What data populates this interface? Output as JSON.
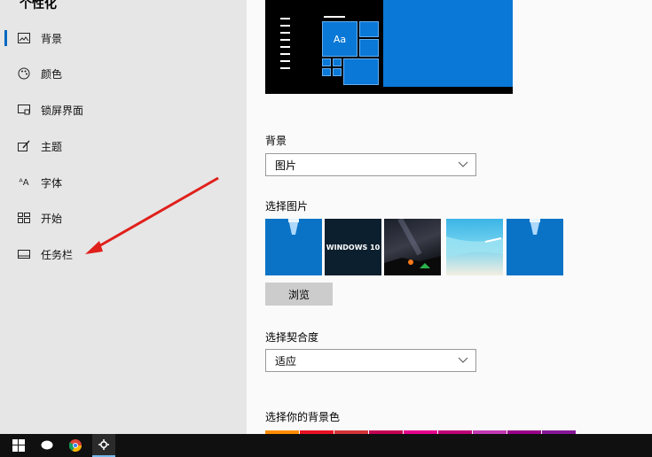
{
  "sidebar": {
    "title": "个性化",
    "items": [
      {
        "label": "背景",
        "icon": "picture-icon",
        "selected": true
      },
      {
        "label": "颜色",
        "icon": "palette-icon",
        "selected": false
      },
      {
        "label": "锁屏界面",
        "icon": "lock-screen-icon",
        "selected": false
      },
      {
        "label": "主题",
        "icon": "theme-icon",
        "selected": false
      },
      {
        "label": "字体",
        "icon": "font-icon",
        "selected": false
      },
      {
        "label": "开始",
        "icon": "start-icon",
        "selected": false
      },
      {
        "label": "任务栏",
        "icon": "taskbar-icon",
        "selected": false
      }
    ]
  },
  "preview": {
    "tile_text": "Aa"
  },
  "background": {
    "label": "背景",
    "value": "图片"
  },
  "choose_picture": {
    "label": "选择图片",
    "thumbnails": [
      "blue-light-icon",
      "windows10-text-image",
      "night-sky-image",
      "beach-image",
      "blue-light-icon"
    ],
    "thumbnail_text": "WINDOWS 10",
    "browse_label": "浏览"
  },
  "fit": {
    "label": "选择契合度",
    "value": "适应"
  },
  "bg_color": {
    "label": "选择你的背景色",
    "swatches": [
      "#ff8c00",
      "#e81123",
      "#d13438",
      "#c30052",
      "#e3008c",
      "#bf0077",
      "#c239b3",
      "#9a0089",
      "#881798"
    ]
  },
  "colors": {
    "accent": "#0067c0",
    "arrow": "#e0201b",
    "taskbar": "#101010"
  },
  "taskbar": {
    "icons": [
      "windows-start-icon",
      "chat-icon",
      "chrome-icon",
      "settings-gear-icon"
    ]
  }
}
